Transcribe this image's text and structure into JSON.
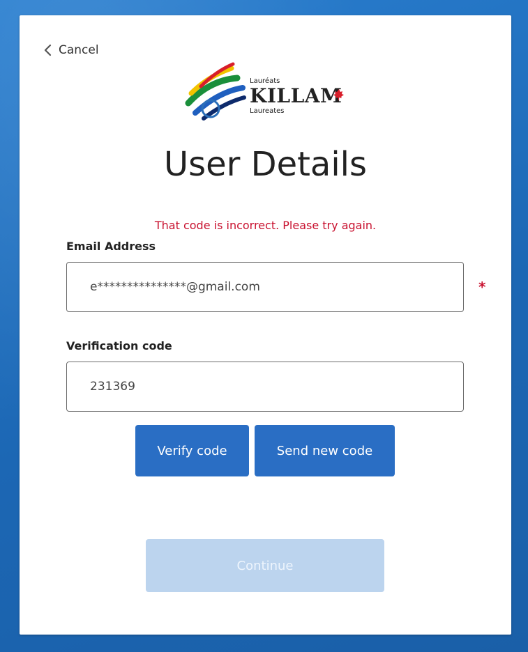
{
  "header": {
    "cancel_label": "Cancel"
  },
  "logo": {
    "line1": "Lauréats",
    "line2": "KILLAM",
    "line3": "Laureates"
  },
  "page": {
    "title": "User Details",
    "error_message": "That code is incorrect. Please try again."
  },
  "form": {
    "email": {
      "label": "Email Address",
      "value": "e***************@gmail.com",
      "required_marker": "*"
    },
    "verification": {
      "label": "Verification code",
      "value": "231369"
    }
  },
  "buttons": {
    "verify": "Verify code",
    "send_new": "Send new code",
    "continue": "Continue"
  },
  "colors": {
    "background": "#1f6fbe",
    "primary_button": "#2a6ec4",
    "disabled_button": "#bcd4ee",
    "error": "#c8102e"
  },
  "icons": {
    "back": "chevron-left-icon",
    "flag": "maple-leaf-icon"
  }
}
